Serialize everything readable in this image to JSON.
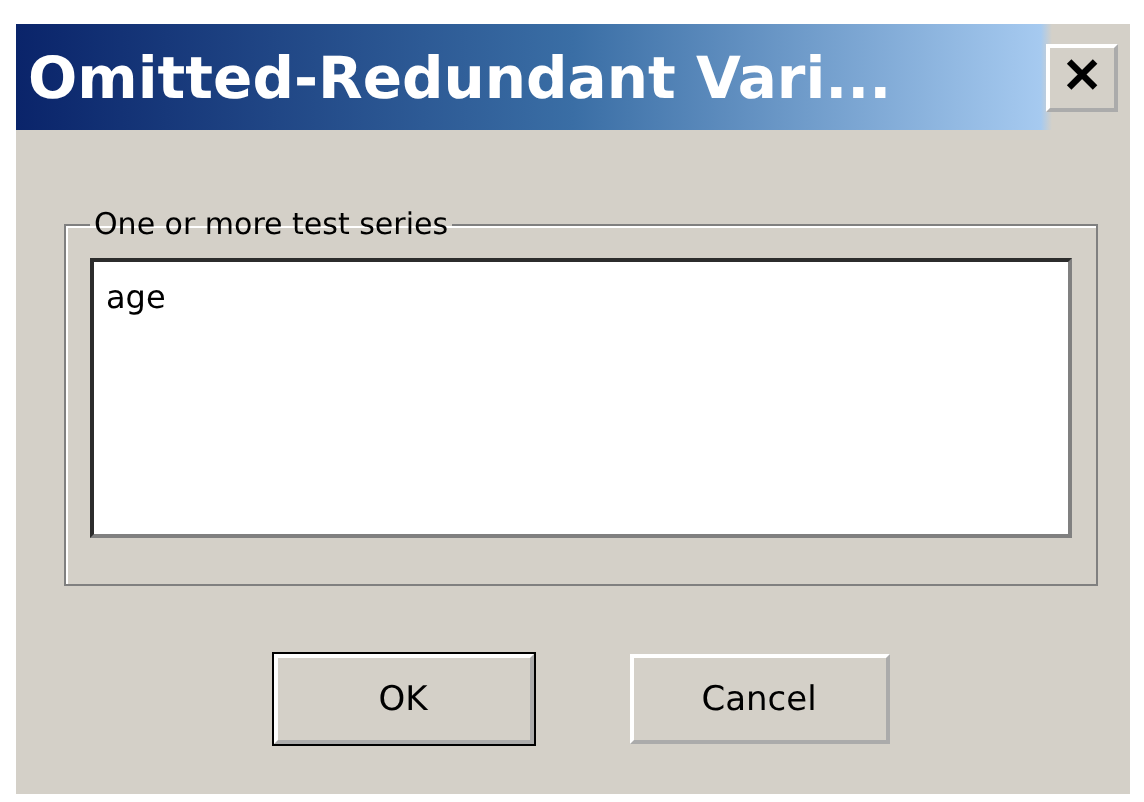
{
  "window": {
    "title": "Omitted-Redundant Vari...",
    "close": "✕"
  },
  "group": {
    "label": "One or more test series",
    "value": "age"
  },
  "buttons": [
    {
      "label": "OK",
      "default": true
    },
    {
      "label": "Cancel",
      "default": false
    }
  ]
}
